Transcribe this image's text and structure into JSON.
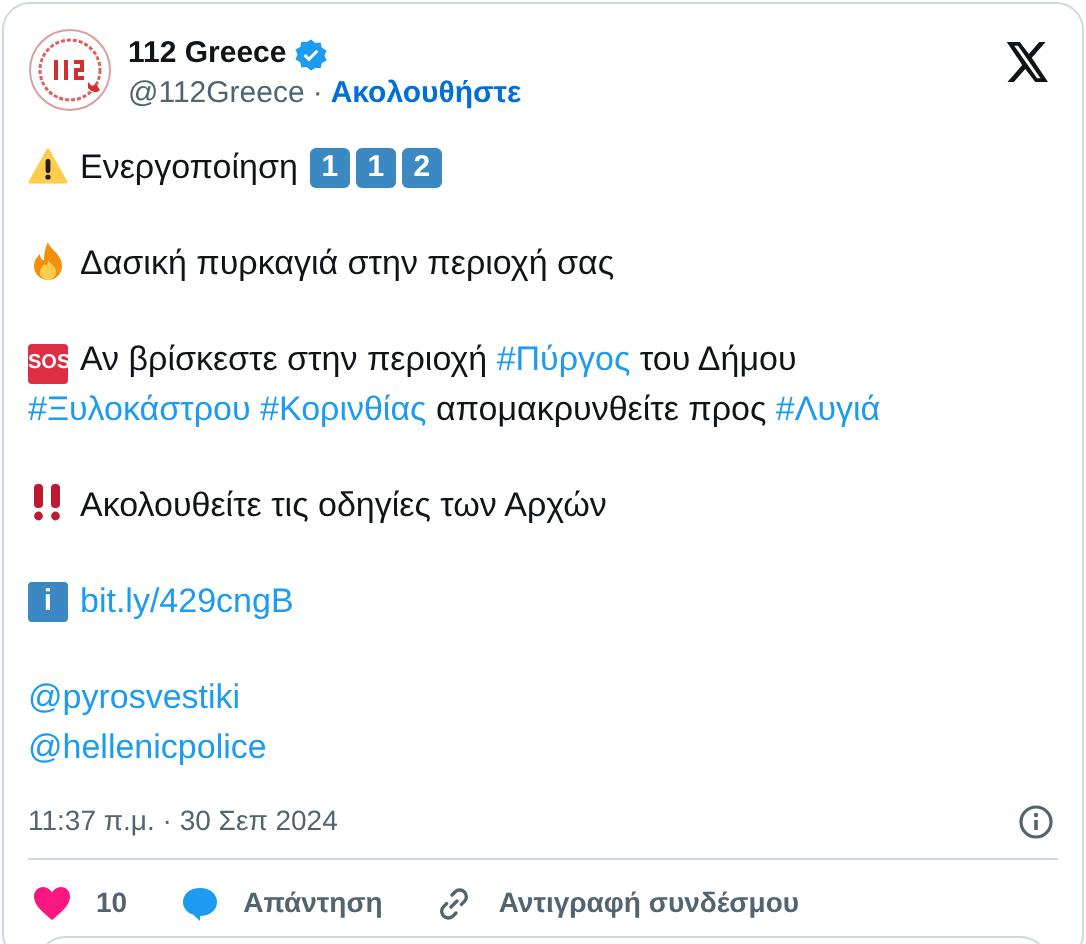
{
  "author": {
    "name": "112 Greece",
    "verified": true,
    "handle": "@112Greece",
    "separator": "·",
    "follow": "Ακολουθήστε"
  },
  "paragraphs": [
    [
      {
        "kind": "warning"
      },
      {
        "kind": "text",
        "text": "Ενεργοποίηση"
      },
      {
        "kind": "keycap",
        "text": "1"
      },
      {
        "kind": "keycap",
        "text": "1"
      },
      {
        "kind": "keycap",
        "text": "2"
      }
    ],
    [
      {
        "kind": "fire"
      },
      {
        "kind": "text",
        "text": "Δασική πυρκαγιά στην περιοχή σας"
      }
    ],
    [
      {
        "kind": "badge",
        "text": "SOS"
      },
      {
        "kind": "text",
        "text": "Αν βρίσκεστε στην περιοχή "
      },
      {
        "kind": "tag",
        "text": "#Πύργος"
      },
      {
        "kind": "text",
        "text": " του Δήμου"
      },
      {
        "kind": "break"
      },
      {
        "kind": "tag",
        "text": "#Ξυλοκάστρου"
      },
      {
        "kind": "tag",
        "text": "#Κορινθίας"
      },
      {
        "kind": "text",
        "text": " απομακρυνθείτε προς "
      },
      {
        "kind": "tag",
        "text": "#Λυγιά"
      }
    ],
    [
      {
        "kind": "exclamation"
      },
      {
        "kind": "text",
        "text": "Ακολουθείτε τις οδηγίες των Αρχών"
      }
    ],
    [
      {
        "kind": "info",
        "text": "i"
      },
      {
        "kind": "link",
        "text": "bit.ly/429cngB"
      }
    ],
    [
      {
        "kind": "mention",
        "text": "@pyrosvestiki"
      },
      {
        "kind": "break"
      },
      {
        "kind": "mention",
        "text": "@hellenicpolice"
      }
    ]
  ],
  "timestamp": "11:37 π.μ. · 30 Σεπ 2024",
  "actions": [
    {
      "kind": "like",
      "label": "10"
    },
    {
      "kind": "reply",
      "label": "Απάντηση"
    },
    {
      "kind": "copy",
      "label": "Αντιγραφή συνδέσμου"
    }
  ]
}
